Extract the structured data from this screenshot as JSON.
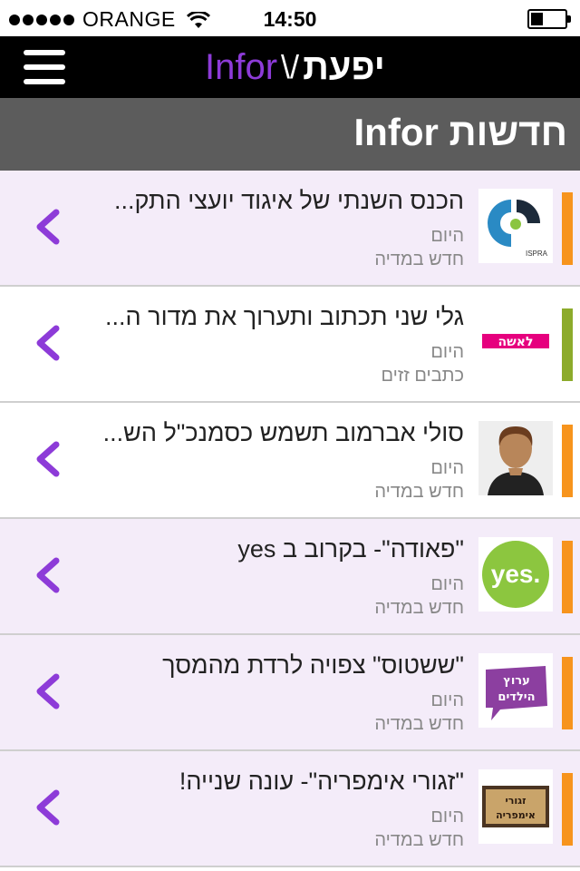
{
  "status_bar": {
    "carrier": "ORANGE",
    "time": "14:50",
    "battery_level": 0.35,
    "signal_bars": 5
  },
  "header": {
    "logo_latin": "Infor",
    "logo_hebrew": "יפעת",
    "logo_mark": "\\/"
  },
  "section": {
    "title": "חדשות Infor"
  },
  "colors": {
    "accent_purple": "#8d3bd8",
    "orange": "#f7941d",
    "green": "#8cab2b",
    "shaded_row": "#f4ecf9"
  },
  "news": [
    {
      "headline": "הכנס השנתי של איגוד יועצי התק...",
      "date": "היום",
      "category": "חדש במדיה",
      "thumb": "ispra-logo",
      "bar_color": "#f7941d",
      "shaded": true,
      "thumb_text": "ISPRA"
    },
    {
      "headline": "גלי שני תכתוב ותערוך את מדור ה...",
      "date": "היום",
      "category": "כתבים זזים",
      "thumb": "laisha-logo",
      "bar_color": "#8cab2b",
      "shaded": false,
      "thumb_text": "לאשה"
    },
    {
      "headline": "סולי אברמוב תשמש כסמנכ\"ל הש...",
      "date": "היום",
      "category": "חדש במדיה",
      "thumb": "portrait-photo",
      "bar_color": "#f7941d",
      "shaded": false,
      "thumb_text": ""
    },
    {
      "headline": "\"פאודה\"- בקרוב ב yes",
      "date": "היום",
      "category": "חדש במדיה",
      "thumb": "yes-logo",
      "bar_color": "#f7941d",
      "shaded": true,
      "thumb_text": "yes."
    },
    {
      "headline": "\"ששטוס\" צפויה לרדת מהמסך",
      "date": "היום",
      "category": "חדש במדיה",
      "thumb": "kids-channel-logo",
      "bar_color": "#f7941d",
      "shaded": true,
      "thumb_text": "ערוץ הילדים"
    },
    {
      "headline": "\"זגורי אימפריה\"- עונה שנייה!",
      "date": "היום",
      "category": "חדש במדיה",
      "thumb": "zaguri-logo",
      "bar_color": "#f7941d",
      "shaded": true,
      "thumb_text": "זגורי אימפריה"
    }
  ]
}
